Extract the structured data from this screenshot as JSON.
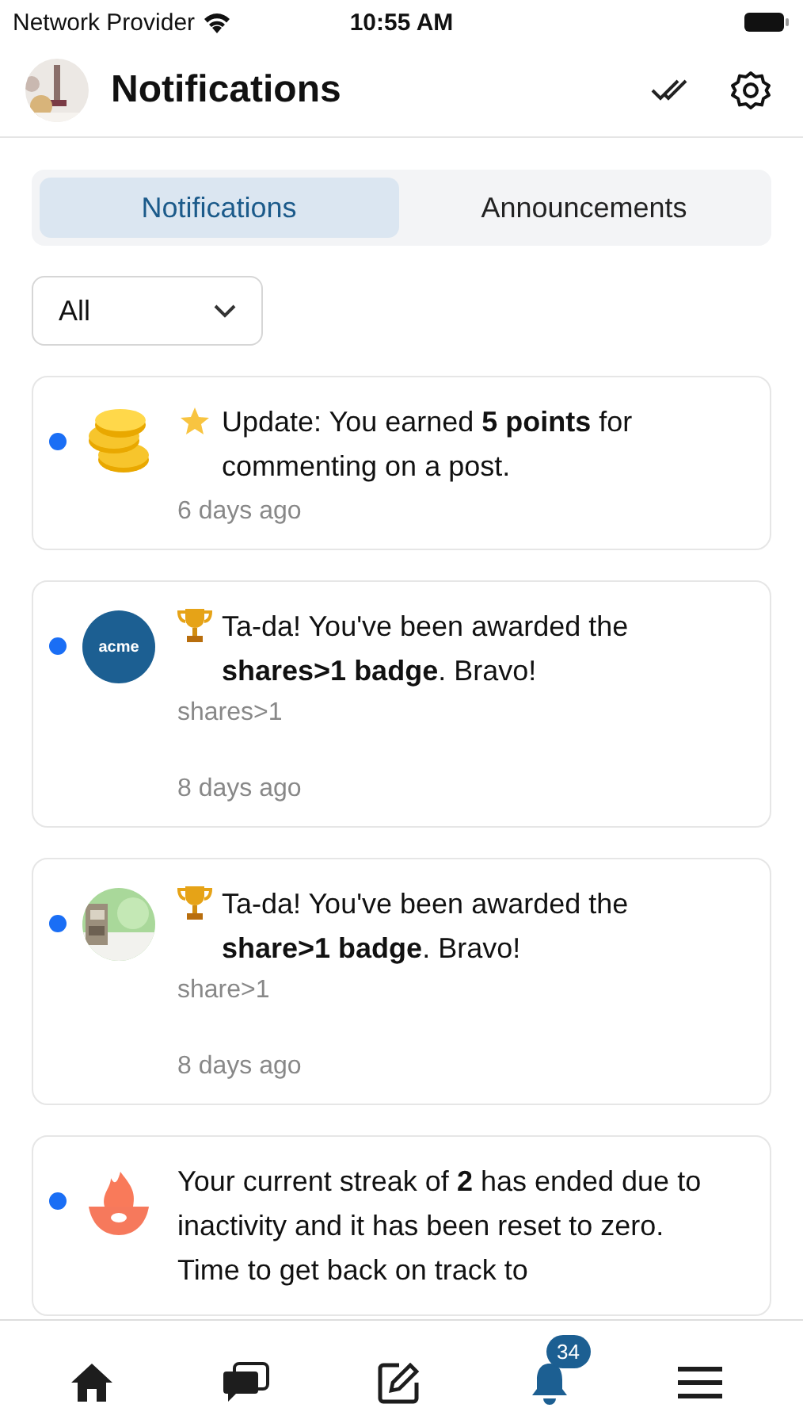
{
  "status_bar": {
    "carrier": "Network Provider",
    "time": "10:55 AM"
  },
  "header": {
    "title": "Notifications"
  },
  "tabs": [
    {
      "label": "Notifications",
      "selected": true
    },
    {
      "label": "Announcements",
      "selected": false
    }
  ],
  "filter": {
    "value": "All"
  },
  "notifications": [
    {
      "unread": true,
      "avatar": {
        "kind": "coins"
      },
      "emblem": {
        "kind": "star"
      },
      "message": "Update: You earned **5 points** for commenting on a post.",
      "time": "6 days ago"
    },
    {
      "unread": true,
      "avatar": {
        "kind": "logo",
        "text": "acme"
      },
      "emblem": {
        "kind": "trophy"
      },
      "message": "Ta-da! You've been awarded the **shares>1 badge**. Bravo!",
      "detail": "shares>1",
      "time": "8 days ago"
    },
    {
      "unread": true,
      "emblem": {
        "kind": "trophy"
      },
      "message": "Ta-da! You've been awarded the **share>1 badge**. Bravo!",
      "detail": "share>1",
      "time": "8 days ago"
    },
    {
      "unread": true,
      "avatar": {
        "kind": "fire"
      },
      "message": "Your current streak of **2** has ended due to inactivity and it has been reset to zero. Time to get back on track to"
    }
  ],
  "tab_bar": [
    {
      "kind": "home",
      "selected": false
    },
    {
      "kind": "chat",
      "selected": false
    },
    {
      "kind": "compose",
      "selected": false
    },
    {
      "kind": "bell",
      "selected": true,
      "badge": "34"
    },
    {
      "kind": "menu",
      "selected": false
    }
  ]
}
